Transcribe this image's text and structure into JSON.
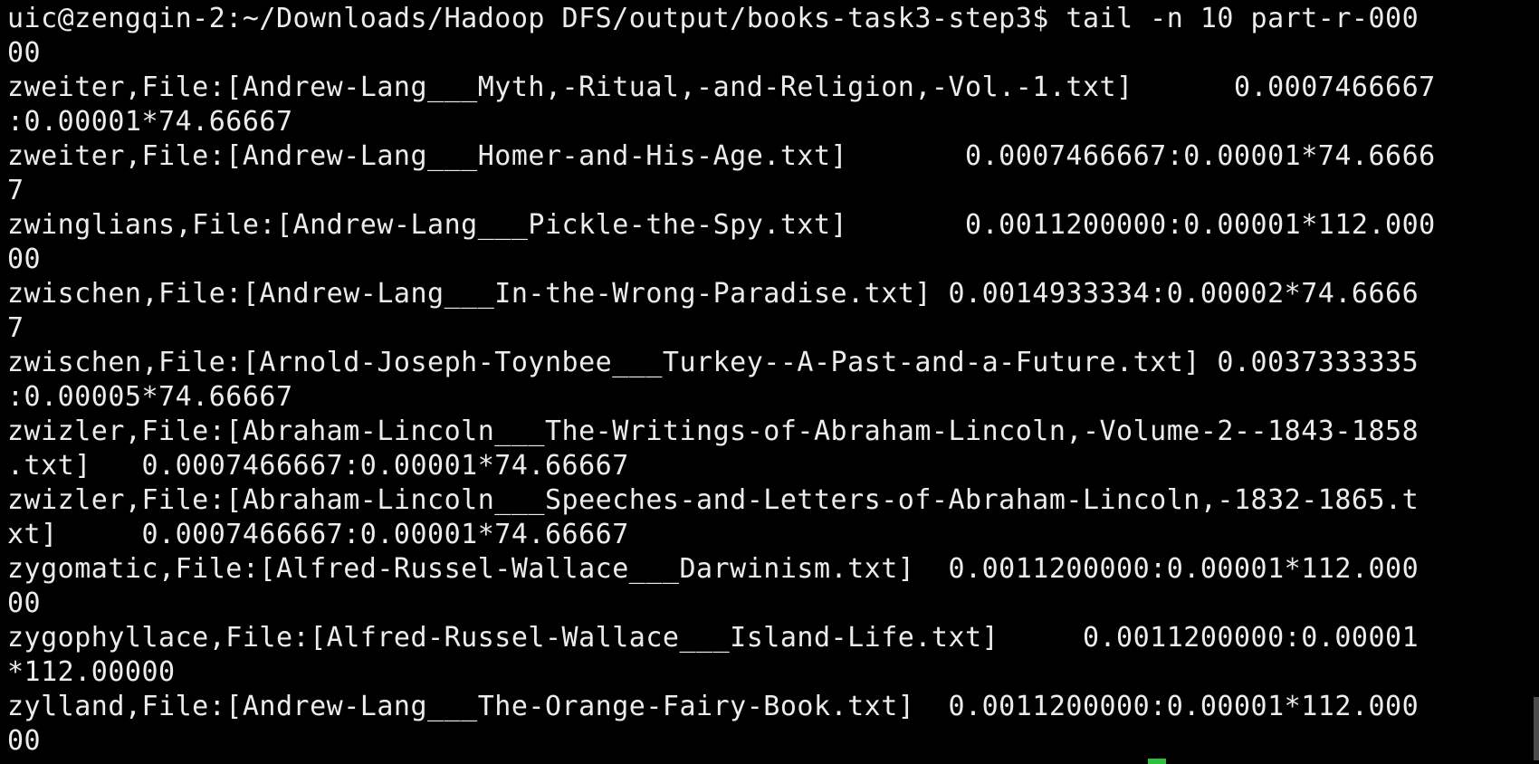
{
  "terminal": {
    "rows": [
      "uic@zengqin-2:~/Downloads/Hadoop DFS/output/books-task3-step3$ tail -n 10 part-r-000",
      "00",
      "zweiter,File:[Andrew-Lang___Myth,-Ritual,-and-Religion,-Vol.-1.txt]      0.0007466667",
      ":0.00001*74.66667",
      "zweiter,File:[Andrew-Lang___Homer-and-His-Age.txt]       0.0007466667:0.00001*74.6666",
      "7",
      "zwinglians,File:[Andrew-Lang___Pickle-the-Spy.txt]       0.0011200000:0.00001*112.000",
      "00",
      "zwischen,File:[Andrew-Lang___In-the-Wrong-Paradise.txt] 0.0014933334:0.00002*74.6666",
      "7",
      "zwischen,File:[Arnold-Joseph-Toynbee___Turkey--A-Past-and-a-Future.txt] 0.0037333335",
      ":0.00005*74.66667",
      "zwizler,File:[Abraham-Lincoln___The-Writings-of-Abraham-Lincoln,-Volume-2--1843-1858",
      ".txt]   0.0007466667:0.00001*74.66667",
      "zwizler,File:[Abraham-Lincoln___Speeches-and-Letters-of-Abraham-Lincoln,-1832-1865.t",
      "xt]     0.0007466667:0.00001*74.66667",
      "zygomatic,File:[Alfred-Russel-Wallace___Darwinism.txt]  0.0011200000:0.00001*112.000",
      "00",
      "zygophyllace,File:[Alfred-Russel-Wallace___Island-Life.txt]     0.0011200000:0.00001",
      "*112.00000",
      "zylland,File:[Andrew-Lang___The-Orange-Fairy-Book.txt]  0.0011200000:0.00001*112.000",
      "00"
    ]
  },
  "colors": {
    "background": "#000000",
    "foreground": "#ececec",
    "cursor": "#2fbf3a"
  }
}
